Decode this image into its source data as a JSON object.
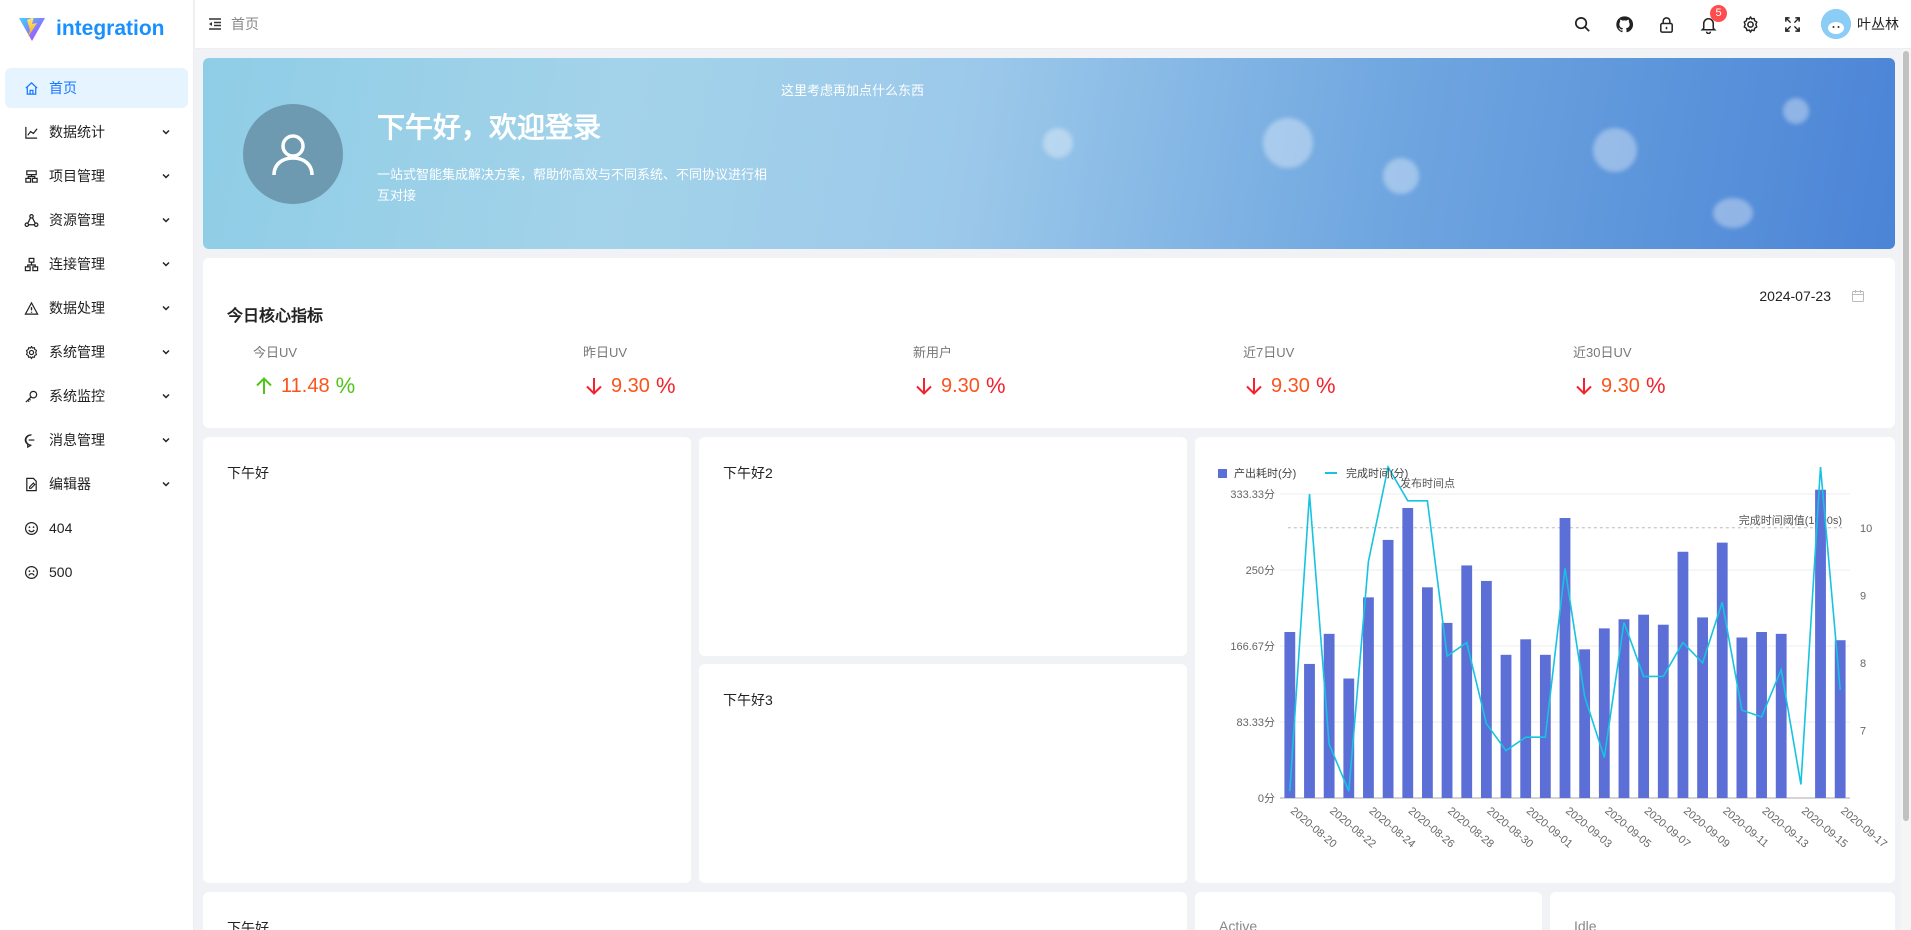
{
  "app": {
    "name": "integration"
  },
  "sidebar": {
    "items": [
      {
        "label": "首页",
        "icon": "home-icon",
        "active": true,
        "expandable": false
      },
      {
        "label": "数据统计",
        "icon": "line-chart-icon",
        "expandable": true
      },
      {
        "label": "项目管理",
        "icon": "cluster-icon",
        "expandable": true
      },
      {
        "label": "资源管理",
        "icon": "share-nodes-icon",
        "expandable": true
      },
      {
        "label": "连接管理",
        "icon": "connection-icon",
        "expandable": true
      },
      {
        "label": "数据处理",
        "icon": "warning-triangle-icon",
        "expandable": true
      },
      {
        "label": "系统管理",
        "icon": "gear-icon",
        "expandable": true
      },
      {
        "label": "系统监控",
        "icon": "key-icon",
        "expandable": true
      },
      {
        "label": "消息管理",
        "icon": "message-icon",
        "expandable": true
      },
      {
        "label": "编辑器",
        "icon": "document-edit-icon",
        "expandable": true
      },
      {
        "label": "404",
        "icon": "smile-icon",
        "expandable": false
      },
      {
        "label": "500",
        "icon": "frown-icon",
        "expandable": false
      }
    ]
  },
  "header": {
    "breadcrumb": "首页",
    "notification_count": "5",
    "username": "叶丛林",
    "icons": [
      "search-icon",
      "github-icon",
      "lock-icon",
      "bell-icon",
      "gear-icon",
      "fullscreen-icon"
    ]
  },
  "banner": {
    "greeting": "下午好，欢迎登录",
    "description": "一站式智能集成解决方案，帮助你高效与不同系统、不同协议进行相互对接",
    "note": "这里考虑再加点什么东西"
  },
  "indicators": {
    "title": "今日核心指标",
    "date": "2024-07-23",
    "items": [
      {
        "label": "今日UV",
        "value": "11.48",
        "unit": "%",
        "trend": "up"
      },
      {
        "label": "昨日UV",
        "value": "9.30",
        "unit": "%",
        "trend": "down"
      },
      {
        "label": "新用户",
        "value": "9.30",
        "unit": "%",
        "trend": "down"
      },
      {
        "label": "近7日UV",
        "value": "9.30",
        "unit": "%",
        "trend": "down"
      },
      {
        "label": "近30日UV",
        "value": "9.30",
        "unit": "%",
        "trend": "down"
      }
    ]
  },
  "panels": {
    "p1": "下午好",
    "p2": "下午好2",
    "p3": "下午好3",
    "p4": "下午好",
    "active": "Active",
    "idle": "Idle"
  },
  "colors": {
    "accent": "#1677ff",
    "bar": "#5b6fd6",
    "line": "#17c3e0",
    "up": "#52c41a",
    "down": "#f5222d"
  },
  "chart_data": {
    "type": "bar",
    "legend_position": "top-left",
    "series": [
      {
        "name": "产出耗时(分)",
        "type": "bar",
        "axis": "left",
        "values": [
          182,
          147,
          180,
          131,
          220,
          283,
          318,
          231,
          192,
          255,
          238,
          157,
          174,
          157,
          307,
          163,
          186,
          196,
          201,
          190,
          270,
          198,
          280,
          176,
          182,
          180,
          0,
          338,
          173
        ]
      },
      {
        "name": "完成时间(分)",
        "type": "line",
        "axis": "right",
        "values": [
          6.1,
          10.5,
          6.8,
          6.1,
          9.5,
          10.9,
          10.4,
          10.4,
          8.1,
          8.3,
          7.1,
          6.7,
          6.9,
          6.9,
          9.4,
          7.5,
          6.6,
          8.6,
          7.8,
          7.8,
          8.3,
          8.0,
          8.9,
          7.3,
          7.2,
          7.9,
          6.2,
          10.9,
          7.6
        ]
      }
    ],
    "x": [
      "2020-08-20",
      "2020-08-21",
      "2020-08-22",
      "2020-08-23",
      "2020-08-24",
      "2020-08-25",
      "2020-08-26",
      "2020-08-27",
      "2020-08-28",
      "2020-08-29",
      "2020-08-30",
      "2020-08-31",
      "2020-09-01",
      "2020-09-02",
      "2020-09-03",
      "2020-09-04",
      "2020-09-05",
      "2020-09-06",
      "2020-09-07",
      "2020-09-08",
      "2020-09-09",
      "2020-09-10",
      "2020-09-11",
      "2020-09-12",
      "2020-09-13",
      "2020-09-14",
      "2020-09-15",
      "2020-09-16",
      "2020-09-17"
    ],
    "x_tick_labels": [
      "2020-08-20",
      "2020-08-22",
      "2020-08-24",
      "2020-08-26",
      "2020-08-28",
      "2020-08-30",
      "2020-09-01",
      "2020-09-03",
      "2020-09-05",
      "2020-09-07",
      "2020-09-09",
      "2020-09-11",
      "2020-09-13",
      "2020-09-15",
      "2020-09-17"
    ],
    "y_left": {
      "ticks": [
        "0分",
        "83.33分",
        "166.67分",
        "250分",
        "333.33分"
      ],
      "ylim": [
        0,
        333.33
      ]
    },
    "y_right": {
      "ticks": [
        "7",
        "8",
        "9",
        "10"
      ],
      "ylim": [
        6,
        10.5
      ]
    },
    "annotations": [
      {
        "text": "发布时间点"
      },
      {
        "text": "完成时间阈值(1000s)",
        "value": 10
      }
    ],
    "grid": true
  }
}
